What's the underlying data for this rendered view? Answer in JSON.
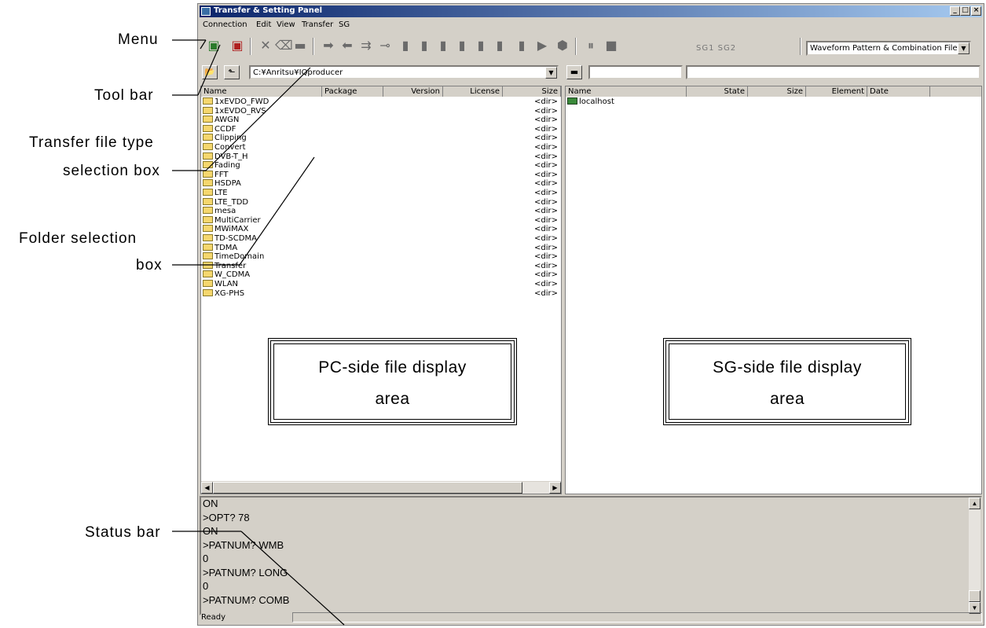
{
  "annotations": {
    "menu": "Menu",
    "tool_bar": "Tool bar",
    "transfer_file_type_line1": "Transfer file type",
    "transfer_file_type_line2": "selection box",
    "folder_selection_line1": "Folder selection",
    "folder_selection_line2": "box",
    "status_bar": "Status bar"
  },
  "window": {
    "title": "Transfer & Setting Panel",
    "controls": [
      "_",
      "□",
      "×"
    ]
  },
  "menu": [
    "Connection",
    "Edit",
    "View",
    "Transfer",
    "SG"
  ],
  "toolbar": {
    "sg_text": "SG1 SG2",
    "file_type": "Waveform Pattern & Combination File",
    "icons": [
      "connect-icon",
      "disconnect-icon",
      "delete-icon",
      "rename-icon",
      "folder-icon",
      "transfer-right-icon",
      "transfer-left-icon",
      "transfer-both-icon",
      "key-icon",
      "load-c-icon",
      "load-fc-icon",
      "load-a-icon",
      "load-b-icon",
      "load-fa-icon",
      "load-fb-icon",
      "play-icon",
      "settings-icon",
      "pause-icon",
      "stop-icon"
    ]
  },
  "pc_pane": {
    "path": "C:¥Anritsu¥IQproducer",
    "columns": [
      "Name",
      "Package",
      "Version",
      "License",
      "Size"
    ],
    "rows": [
      {
        "name": "1xEVDO_FWD",
        "size": "<dir>"
      },
      {
        "name": "1xEVDO_RVS",
        "size": "<dir>"
      },
      {
        "name": "AWGN",
        "size": "<dir>"
      },
      {
        "name": "CCDF",
        "size": "<dir>"
      },
      {
        "name": "Clipping",
        "size": "<dir>"
      },
      {
        "name": "Convert",
        "size": "<dir>"
      },
      {
        "name": "DVB-T_H",
        "size": "<dir>"
      },
      {
        "name": "Fading",
        "size": "<dir>"
      },
      {
        "name": "FFT",
        "size": "<dir>"
      },
      {
        "name": "HSDPA",
        "size": "<dir>"
      },
      {
        "name": "LTE",
        "size": "<dir>"
      },
      {
        "name": "LTE_TDD",
        "size": "<dir>"
      },
      {
        "name": "mesa",
        "size": "<dir>"
      },
      {
        "name": "MultiCarrier",
        "size": "<dir>"
      },
      {
        "name": "MWiMAX",
        "size": "<dir>"
      },
      {
        "name": "TD-SCDMA",
        "size": "<dir>"
      },
      {
        "name": "TDMA",
        "size": "<dir>"
      },
      {
        "name": "TimeDomain",
        "size": "<dir>"
      },
      {
        "name": "Transfer",
        "size": "<dir>"
      },
      {
        "name": "W_CDMA",
        "size": "<dir>"
      },
      {
        "name": "WLAN",
        "size": "<dir>"
      },
      {
        "name": "XG-PHS",
        "size": "<dir>"
      }
    ],
    "callout_line1": "PC-side file display",
    "callout_line2": "area"
  },
  "sg_pane": {
    "columns": [
      "Name",
      "State",
      "Size",
      "Element",
      "Date"
    ],
    "rows": [
      {
        "name": "localhost"
      }
    ],
    "callout_line1": "SG-side file display",
    "callout_line2": "area"
  },
  "console": {
    "lines": [
      "ON",
      ">OPT? 78",
      "ON",
      ">PATNUM? WMB",
      "0",
      ">PATNUM? LONG",
      "0",
      ">PATNUM? COMB"
    ]
  },
  "status": {
    "text": "Ready"
  }
}
